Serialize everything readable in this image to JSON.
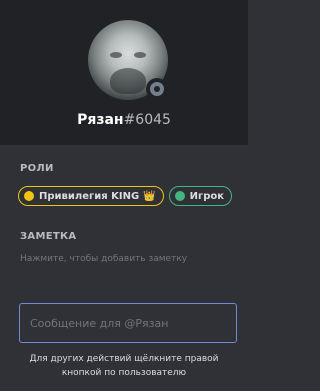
{
  "profile": {
    "username": "Рязан",
    "discriminator": "#6045",
    "status": "offline",
    "status_color": "#747f8d"
  },
  "roles_section": {
    "title": "РОЛИ",
    "roles": [
      {
        "name": "Привилегия KING",
        "icon": "crown-icon",
        "color": "#f1c40f"
      },
      {
        "name": "Игрок",
        "color": "#43b581"
      }
    ]
  },
  "note_section": {
    "title": "ЗАМЕТКА",
    "placeholder": "Нажмите, чтобы добавить заметку"
  },
  "message": {
    "placeholder": "Сообщение для @Рязан",
    "value": ""
  },
  "footer": {
    "hint": "Для других действий щёлкните правой кнопкой по пользователю"
  },
  "colors": {
    "header_bg": "#202225",
    "body_bg": "#2f3136",
    "accent": "#7289da"
  }
}
